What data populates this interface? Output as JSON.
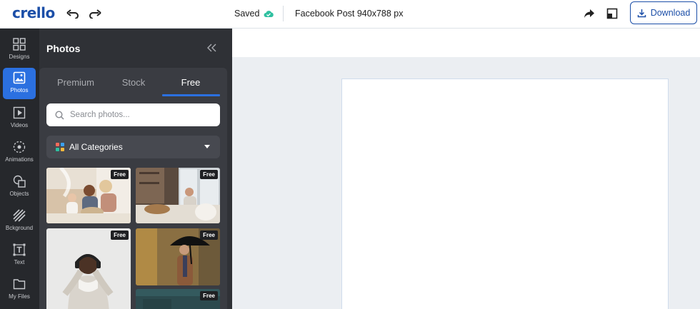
{
  "header": {
    "logo": "crello",
    "saved_label": "Saved",
    "document_title": "Facebook Post 940x788 px",
    "download_label": "Download"
  },
  "rail": {
    "items": [
      {
        "label": "Designs",
        "icon": "grid-icon"
      },
      {
        "label": "Photos",
        "icon": "image-icon",
        "active": true
      },
      {
        "label": "Videos",
        "icon": "play-icon"
      },
      {
        "label": "Animations",
        "icon": "animation-icon"
      },
      {
        "label": "Objects",
        "icon": "shapes-icon"
      },
      {
        "label": "Bckground",
        "icon": "background-icon"
      },
      {
        "label": "Text",
        "icon": "text-icon"
      },
      {
        "label": "My Files",
        "icon": "folder-icon"
      }
    ]
  },
  "panel": {
    "title": "Photos",
    "tabs": [
      "Premium",
      "Stock",
      "Free"
    ],
    "active_tab": "Free",
    "search_placeholder": "Search photos...",
    "category": "All Categories",
    "badge": "Free",
    "photos": [
      {
        "badge": "Free"
      },
      {
        "badge": "Free"
      },
      {
        "badge": "Free"
      },
      {
        "badge": "Free"
      },
      {
        "badge": "Free"
      }
    ]
  },
  "colors": {
    "accent": "#2b70e0",
    "brand": "#1c4fa8",
    "saved_cloud": "#2fc0a0"
  }
}
